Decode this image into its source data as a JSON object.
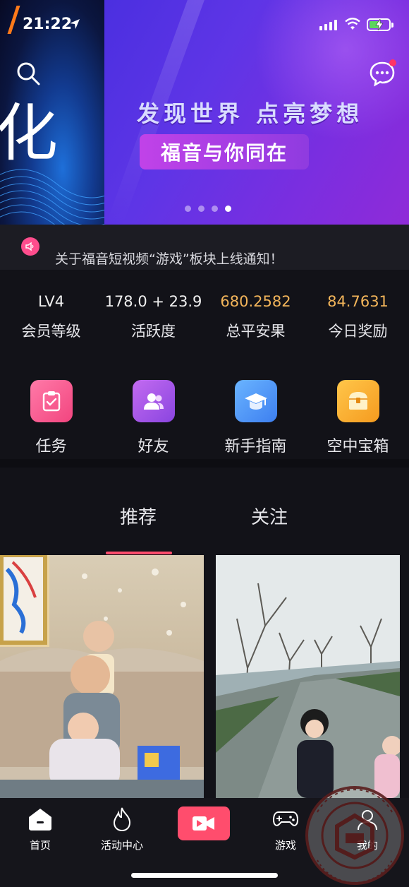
{
  "status_bar": {
    "time": "21:22"
  },
  "banner": {
    "left_text": "化",
    "headline": "发现世界 点亮梦想",
    "pill_text": "福音与你同在",
    "slide_count": 4,
    "active_slide": 4
  },
  "notice": {
    "text": "关于福音短视频“游戏”板块上线通知！"
  },
  "stats": [
    {
      "value": "LV4",
      "label": "会员等级",
      "highlight": false
    },
    {
      "value": "178.0 + 23.9",
      "label": "活跃度",
      "highlight": false
    },
    {
      "value": "680.2582",
      "label": "总平安果",
      "highlight": true
    },
    {
      "value": "84.7631",
      "label": "今日奖励",
      "highlight": true
    }
  ],
  "shortcuts": [
    {
      "label": "任务",
      "icon": "clipboard-check-icon"
    },
    {
      "label": "好友",
      "icon": "friends-icon"
    },
    {
      "label": "新手指南",
      "icon": "graduation-cap-icon"
    },
    {
      "label": "空中宝箱",
      "icon": "treasure-chest-icon"
    }
  ],
  "tabs": {
    "recommend": "推荐",
    "follow": "关注",
    "active": "推荐"
  },
  "nav": {
    "home": "首页",
    "activity": "活动中心",
    "record": "",
    "game": "游戏",
    "mine": "我的"
  },
  "watermark": {
    "text": "私 慕 WWW.SIMUODE.COM"
  },
  "colors": {
    "background": "#121218",
    "accent_pink": "#ff4d6d",
    "gold_value": "#f3b55a",
    "banner_purple": "#5e35e6"
  }
}
